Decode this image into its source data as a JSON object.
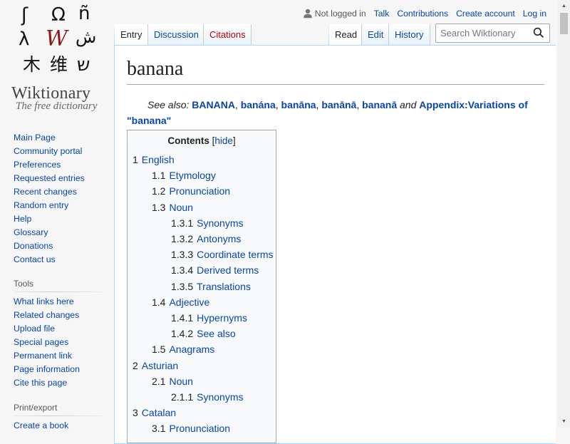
{
  "logo": {
    "glyphs": [
      "ʃ",
      "Ω",
      "ñ",
      "λ",
      "W",
      "ش",
      "木",
      "维",
      "ש"
    ],
    "tagline_main": "Wiktionary",
    "tagline_sub": "The free dictionary"
  },
  "personal": {
    "not_logged_in": "Not logged in",
    "talk": "Talk",
    "contributions": "Contributions",
    "create_account": "Create account",
    "log_in": "Log in"
  },
  "tabs": {
    "entry": "Entry",
    "discussion": "Discussion",
    "citations": "Citations",
    "read": "Read",
    "edit": "Edit",
    "history": "History"
  },
  "search": {
    "placeholder": "Search Wiktionary"
  },
  "sidebar": {
    "navigation": [
      "Main Page",
      "Community portal",
      "Preferences",
      "Requested entries",
      "Recent changes",
      "Random entry",
      "Help",
      "Glossary",
      "Donations",
      "Contact us"
    ],
    "tools_heading": "Tools",
    "tools": [
      "What links here",
      "Related changes",
      "Upload file",
      "Special pages",
      "Permanent link",
      "Page information",
      "Cite this page"
    ],
    "print_heading": "Print/export",
    "print": [
      "Create a book"
    ]
  },
  "page": {
    "title": "banana",
    "see_also_label": "See also:",
    "see_also_links": [
      "BANANA",
      "banána",
      "banāna",
      "banānā",
      "bananā"
    ],
    "sep_comma": ",",
    "and": "and",
    "appendix_link_1": "Appendix:Variations of",
    "appendix_link_2": "\"banana\""
  },
  "toc": {
    "title": "Contents",
    "toggle_open": "[",
    "toggle_label": "hide",
    "toggle_close": "]",
    "items": [
      {
        "num": "1",
        "text": "English",
        "level": 1
      },
      {
        "num": "1.1",
        "text": "Etymology",
        "level": 2
      },
      {
        "num": "1.2",
        "text": "Pronunciation",
        "level": 2
      },
      {
        "num": "1.3",
        "text": "Noun",
        "level": 2
      },
      {
        "num": "1.3.1",
        "text": "Synonyms",
        "level": 3
      },
      {
        "num": "1.3.2",
        "text": "Antonyms",
        "level": 3
      },
      {
        "num": "1.3.3",
        "text": "Coordinate terms",
        "level": 3
      },
      {
        "num": "1.3.4",
        "text": "Derived terms",
        "level": 3
      },
      {
        "num": "1.3.5",
        "text": "Translations",
        "level": 3
      },
      {
        "num": "1.4",
        "text": "Adjective",
        "level": 2
      },
      {
        "num": "1.4.1",
        "text": "Hypernyms",
        "level": 3
      },
      {
        "num": "1.4.2",
        "text": "See also",
        "level": 3
      },
      {
        "num": "1.5",
        "text": "Anagrams",
        "level": 2
      },
      {
        "num": "2",
        "text": "Asturian",
        "level": 1
      },
      {
        "num": "2.1",
        "text": "Noun",
        "level": 2
      },
      {
        "num": "2.1.1",
        "text": "Synonyms",
        "level": 3
      },
      {
        "num": "3",
        "text": "Catalan",
        "level": 1
      },
      {
        "num": "3.1",
        "text": "Pronunciation",
        "level": 2
      }
    ]
  },
  "colors": {
    "link": "#0645ad",
    "new_link": "#ba0000",
    "border": "#a7d7f9"
  }
}
